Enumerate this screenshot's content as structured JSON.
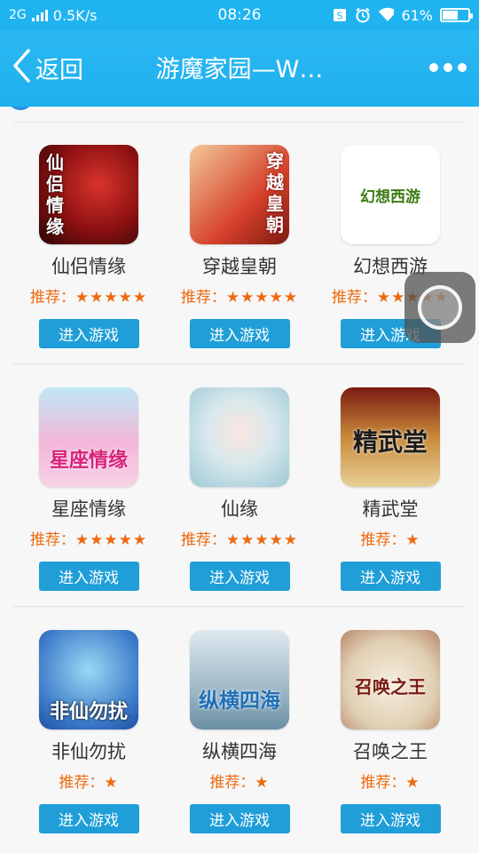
{
  "status_bar": {
    "network": "2G",
    "speed": "0.5K/s",
    "time": "08:26",
    "battery": "61%",
    "battery_level": 0.61,
    "icons": [
      "signal-icon",
      "sim-icon",
      "alarm-icon",
      "wifi-icon",
      "battery-icon"
    ]
  },
  "navbar": {
    "back_label": "返回",
    "title": "游魔家园—W…"
  },
  "colors": {
    "accent": "#1fb4f0",
    "button": "#1f9ed8",
    "rating": "#ee6a0f"
  },
  "games": [
    {
      "name": "仙侣情缘",
      "rating_label": "推荐：",
      "stars": "★★★★★",
      "rating": 5,
      "button": "进入游戏",
      "icon_text": "仙侣情缘"
    },
    {
      "name": "穿越皇朝",
      "rating_label": "推荐：",
      "stars": "★★★★★",
      "rating": 5,
      "button": "进入游戏",
      "icon_text": "穿越皇朝"
    },
    {
      "name": "幻想西游",
      "rating_label": "推荐：",
      "stars": "★★★★★",
      "rating": 5,
      "button": "进入游戏",
      "icon_text": "幻想西游"
    },
    {
      "name": "星座情缘",
      "rating_label": "推荐：",
      "stars": "★★★★★",
      "rating": 5,
      "button": "进入游戏",
      "icon_text": "星座情缘"
    },
    {
      "name": "仙缘",
      "rating_label": "推荐：",
      "stars": "★★★★★",
      "rating": 5,
      "button": "进入游戏",
      "icon_text": ""
    },
    {
      "name": "精武堂",
      "rating_label": "推荐：",
      "stars": "★",
      "rating": 1,
      "button": "进入游戏",
      "icon_text": "精武堂"
    },
    {
      "name": "非仙勿扰",
      "rating_label": "推荐：",
      "stars": "★",
      "rating": 1,
      "button": "进入游戏",
      "icon_text": "非仙勿扰"
    },
    {
      "name": "纵横四海",
      "rating_label": "推荐：",
      "stars": "★",
      "rating": 1,
      "button": "进入游戏",
      "icon_text": "纵横四海"
    },
    {
      "name": "召唤之王",
      "rating_label": "推荐：",
      "stars": "★",
      "rating": 1,
      "button": "进入游戏",
      "icon_text": "召唤之王"
    }
  ]
}
